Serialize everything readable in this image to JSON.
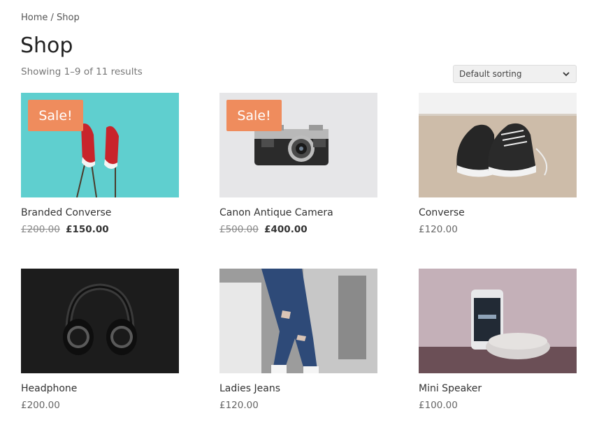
{
  "breadcrumb": {
    "home": "Home",
    "separator": " / ",
    "current": "Shop"
  },
  "page": {
    "title": "Shop",
    "result_count": "Showing 1–9 of 11 results"
  },
  "sorting": {
    "selected": "Default sorting"
  },
  "colors": {
    "sale_badge": "#ef8c5d",
    "text": "#333333",
    "muted": "#777777"
  },
  "products": [
    {
      "name": "Branded Converse",
      "sale_label": "Sale!",
      "regular_price": "£200.00",
      "sale_price": "£150.00",
      "image": "red-sneakers-image"
    },
    {
      "name": "Canon Antique Camera",
      "sale_label": "Sale!",
      "regular_price": "£500.00",
      "sale_price": "£400.00",
      "image": "camera-image"
    },
    {
      "name": "Converse",
      "price": "£120.00",
      "image": "black-sneakers-image"
    },
    {
      "name": "Headphone",
      "price": "£200.00",
      "image": "headphones-image"
    },
    {
      "name": "Ladies Jeans",
      "price": "£120.00",
      "image": "jeans-image"
    },
    {
      "name": "Mini Speaker",
      "price": "£100.00",
      "image": "speaker-image"
    }
  ]
}
